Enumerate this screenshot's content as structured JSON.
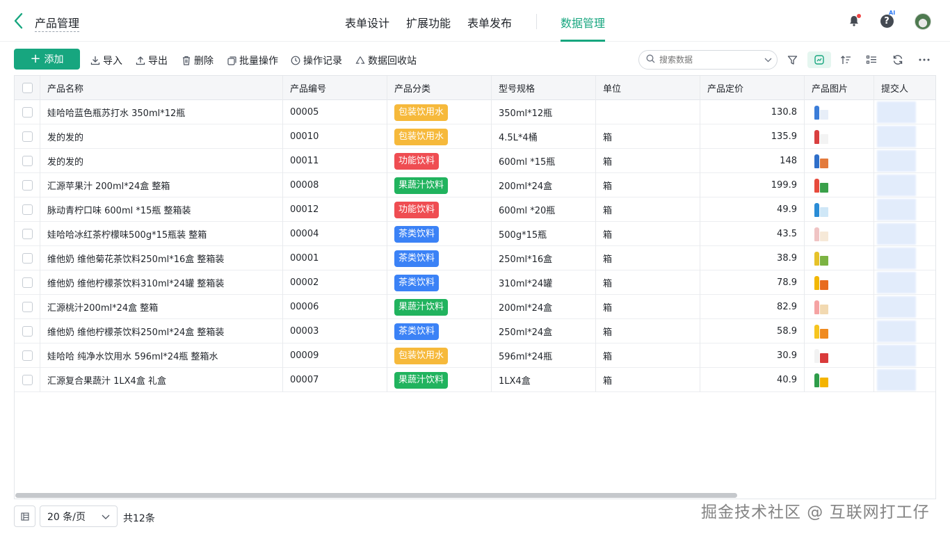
{
  "header": {
    "app_title": "产品管理",
    "tabs": [
      {
        "label": "表单设计"
      },
      {
        "label": "扩展功能"
      },
      {
        "label": "表单发布"
      },
      {
        "label": "数据管理"
      }
    ],
    "active_tab": "数据管理",
    "ai_badge": "AI",
    "help_glyph": "?"
  },
  "toolbar": {
    "add_label": "添加",
    "import_label": "导入",
    "export_label": "导出",
    "delete_label": "删除",
    "batch_label": "批量操作",
    "log_label": "操作记录",
    "recycle_label": "数据回收站",
    "search_placeholder": "搜索数据"
  },
  "table": {
    "columns": [
      "产品名称",
      "产品编号",
      "产品分类",
      "型号规格",
      "单位",
      "产品定价",
      "产品图片",
      "提交人"
    ],
    "category_colors": {
      "包装饮用水": "#f6b93b",
      "功能饮料": "#ef4d52",
      "果蔬汁饮料": "#21b35e",
      "茶类饮料": "#3b82f6"
    },
    "rows": [
      {
        "name": "娃哈哈蓝色瓶苏打水 350ml*12瓶",
        "code": "00005",
        "category": "包装饮用水",
        "spec": "350ml*12瓶",
        "unit": "",
        "price": "130.8",
        "image": "water-pack-icon"
      },
      {
        "name": "发的发的",
        "code": "00010",
        "category": "包装饮用水",
        "spec": "4.5L*4桶",
        "unit": "箱",
        "price": "135.9",
        "image": "water-bottle-icon"
      },
      {
        "name": "发的发的",
        "code": "00011",
        "category": "功能饮料",
        "spec": "600ml *15瓶",
        "unit": "箱",
        "price": "148",
        "image": "sports-drink-icon"
      },
      {
        "name": "汇源苹果汁 200ml*24盒 整箱",
        "code": "00008",
        "category": "果蔬汁饮料",
        "spec": "200ml*24盒",
        "unit": "箱",
        "price": "199.9",
        "image": "juice-box-icon"
      },
      {
        "name": "脉动青柠口味 600ml *15瓶 整箱装",
        "code": "00012",
        "category": "功能饮料",
        "spec": "600ml *20瓶",
        "unit": "箱",
        "price": "49.9",
        "image": "mizone-bottle-icon"
      },
      {
        "name": "娃哈哈冰红茶柠檬味500g*15瓶装 整箱",
        "code": "00004",
        "category": "茶类饮料",
        "spec": "500g*15瓶",
        "unit": "箱",
        "price": "43.5",
        "image": "ice-tea-icon"
      },
      {
        "name": "维他奶 维他菊花茶饮料250ml*16盒 整箱装",
        "code": "00001",
        "category": "茶类饮料",
        "spec": "250ml*16盒",
        "unit": "箱",
        "price": "38.9",
        "image": "tea-box-icon"
      },
      {
        "name": "维他奶 维他柠檬茶饮料310ml*24罐 整箱装",
        "code": "00002",
        "category": "茶类饮料",
        "spec": "310ml*24罐",
        "unit": "箱",
        "price": "78.9",
        "image": "lemon-tea-can-icon"
      },
      {
        "name": "汇源桃汁200ml*24盒 整箱",
        "code": "00006",
        "category": "果蔬汁饮料",
        "spec": "200ml*24盒",
        "unit": "箱",
        "price": "82.9",
        "image": "peach-juice-icon"
      },
      {
        "name": "维他奶 维他柠檬茶饮料250ml*24盒 整箱装",
        "code": "00003",
        "category": "茶类饮料",
        "spec": "250ml*24盒",
        "unit": "箱",
        "price": "58.9",
        "image": "lemon-tea-box-icon"
      },
      {
        "name": "娃哈哈 纯净水饮用水 596ml*24瓶 整箱水",
        "code": "00009",
        "category": "包装饮用水",
        "spec": "596ml*24瓶",
        "unit": "箱",
        "price": "30.9",
        "image": "pure-water-icon"
      },
      {
        "name": "汇源复合果蔬汁 1LX4盒 礼盒",
        "code": "00007",
        "category": "果蔬汁饮料",
        "spec": "1LX4盒",
        "unit": "箱",
        "price": "40.9",
        "image": "gift-box-icon"
      }
    ]
  },
  "footer": {
    "page_size_label": "20 条/页",
    "total_label": "共12条"
  },
  "watermark": "掘金技术社区 @ 互联网打工仔"
}
